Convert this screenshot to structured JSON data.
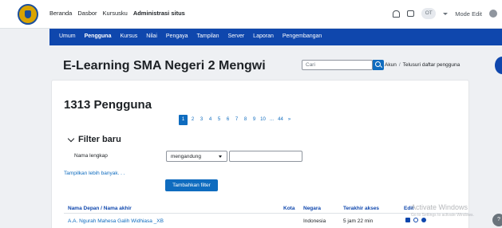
{
  "navbar": {
    "items": [
      {
        "label": "Beranda",
        "active": false
      },
      {
        "label": "Dasbor",
        "active": false
      },
      {
        "label": "Kursusku",
        "active": false
      },
      {
        "label": "Administrasi situs",
        "active": true
      }
    ],
    "avatar_initials": "OT",
    "edit_mode_label": "Mode Edit"
  },
  "secondary_nav": {
    "items": [
      {
        "label": "Umum",
        "active": false
      },
      {
        "label": "Pengguna",
        "active": true
      },
      {
        "label": "Kursus",
        "active": false
      },
      {
        "label": "Nilai",
        "active": false
      },
      {
        "label": "Pengaya",
        "active": false
      },
      {
        "label": "Tampilan",
        "active": false
      },
      {
        "label": "Server",
        "active": false
      },
      {
        "label": "Laporan",
        "active": false
      },
      {
        "label": "Pengembangan",
        "active": false
      }
    ]
  },
  "header": {
    "site_title": "E-Learning SMA Negeri 2 Mengwi",
    "search_placeholder": "Cari",
    "breadcrumb": [
      "Akun",
      "Telusuri daftar pengguna"
    ]
  },
  "main": {
    "heading": "1313 Pengguna",
    "pagination": [
      "1",
      "2",
      "3",
      "4",
      "5",
      "6",
      "7",
      "8",
      "9",
      "10",
      "...",
      "44",
      "»"
    ],
    "pagination_active": "1",
    "filter": {
      "heading": "Filter baru",
      "field_label": "Nama lengkap",
      "operator_value": "mengandung",
      "text_value": "",
      "more_link": "Tampilkan lebih banyak. . .",
      "add_button": "Tambahkan filter"
    },
    "table": {
      "columns": [
        "Nama Depan / Nama akhir",
        "Kota",
        "Negara",
        "Terakhir akses",
        "Edit"
      ],
      "rows": [
        {
          "name": "A.A. Ngurah Mahesa Galih Widhiasa _XB",
          "city": "",
          "country": "Indonesia",
          "last_access": "5 jam 22 min"
        }
      ]
    }
  },
  "overlay": {
    "watermark": "Activate Windows",
    "watermark_sub": "Go to Settings to activate Windows.",
    "help": "?"
  },
  "colors": {
    "primary": "#0f47ad",
    "link": "#0f6cbf",
    "logo": "#d9a400"
  }
}
